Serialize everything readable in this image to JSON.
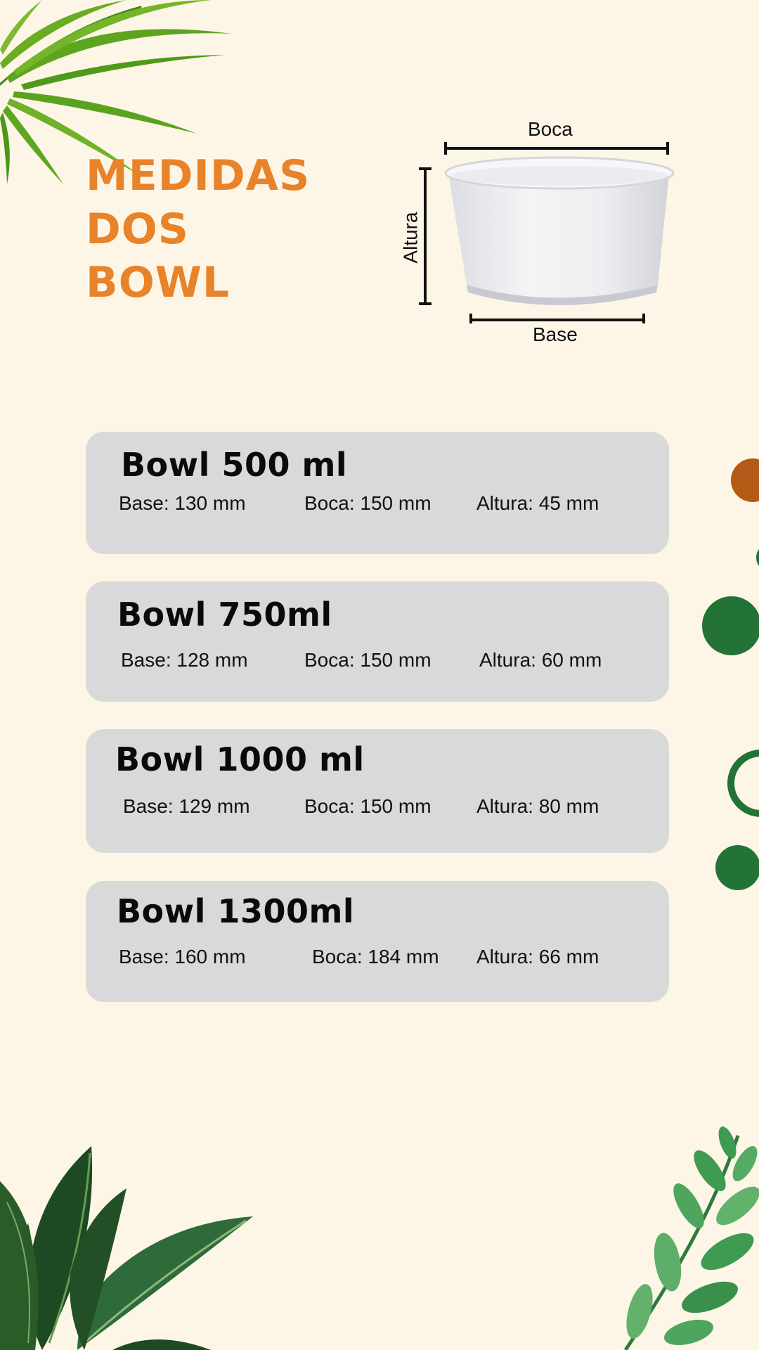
{
  "title": {
    "line1": "MEDIDAS",
    "line2": "DOS",
    "line3": "BOWL"
  },
  "diagram": {
    "boca_label": "Boca",
    "base_label": "Base",
    "altura_label": "Altura"
  },
  "bowls": [
    {
      "name": "Bowl 500 ml",
      "base": "Base: 130 mm",
      "boca": "Boca: 150 mm",
      "altura": "Altura: 45 mm"
    },
    {
      "name": "Bowl 750ml",
      "base": "Base: 128 mm",
      "boca": "Boca: 150 mm",
      "altura": "Altura: 60 mm"
    },
    {
      "name": "Bowl 1000 ml",
      "base": "Base: 129 mm",
      "boca": "Boca: 150 mm",
      "altura": "Altura: 80 mm"
    },
    {
      "name": "Bowl 1300ml",
      "base": "Base: 160 mm",
      "boca": "Boca: 184 mm",
      "altura": "Altura: 66 mm"
    }
  ],
  "colors": {
    "background": "#fdf6e6",
    "title": "#e8832a",
    "card": "#d9d9d9",
    "accent_brown": "#b35a17",
    "accent_green": "#237236"
  },
  "icons": {
    "top_left": "palm-leaf-icon",
    "bottom_left": "tropical-leaves-icon",
    "bottom_right": "branch-leaves-icon",
    "product": "paper-bowl-icon"
  }
}
